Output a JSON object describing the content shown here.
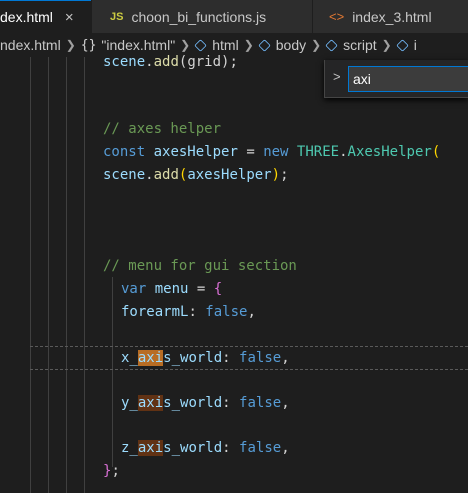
{
  "tabs": [
    {
      "label": "dex.html",
      "close": "×"
    },
    {
      "label": "choon_bi_functions.js",
      "icon_text": "JS"
    },
    {
      "label": "index_3.html",
      "icon_text": "<>"
    }
  ],
  "breadcrumb": {
    "items": [
      "ndex.html",
      "\"index.html\"",
      "html",
      "body",
      "script",
      "i"
    ]
  },
  "find": {
    "toggle": ">",
    "value": "axi"
  },
  "code": {
    "l0": {
      "obj": "scene",
      "dot": ".",
      "fn": "add",
      "rest": "(grid);"
    },
    "c_axes": "// axes helper",
    "l_axes": {
      "kw": "const",
      "name": "axesHelper",
      "eq": " = ",
      "new": "new",
      "ns": "THREE",
      "dot": ".",
      "cls": "AxesHelper",
      "paren": "("
    },
    "l_add": {
      "obj": "scene",
      "dot": ".",
      "fn": "add",
      "p1": "(",
      "arg": "axesHelper",
      "p2": ")",
      "semi": ";"
    },
    "c_menu": "// menu for gui section",
    "l_var": {
      "kw": "var",
      "name": "menu",
      "eq": " = ",
      "brace": "{"
    },
    "l_fore": {
      "key": "forearmL",
      "colon": ": ",
      "val": "false",
      "comma": ","
    },
    "l_x": {
      "pre": "x_",
      "hit": "axi",
      "post": "s_world",
      "colon": ": ",
      "val": "false",
      "comma": ","
    },
    "l_y": {
      "pre": "y_",
      "hit": "axi",
      "post": "s_world",
      "colon": ": ",
      "val": "false",
      "comma": ","
    },
    "l_z": {
      "pre": "z_",
      "hit": "axi",
      "post": "s_world",
      "colon": ": ",
      "val": "false",
      "comma": ","
    },
    "l_end": {
      "brace": "}",
      "semi": ";"
    }
  },
  "colors": {
    "accent": "#0078d4",
    "comment": "#6a9955",
    "keyword": "#569cd6",
    "variable": "#9cdcfe",
    "function": "#dcdcaa",
    "class": "#4ec9b0",
    "find_match": "#613214",
    "current_match": "#b86d24"
  }
}
